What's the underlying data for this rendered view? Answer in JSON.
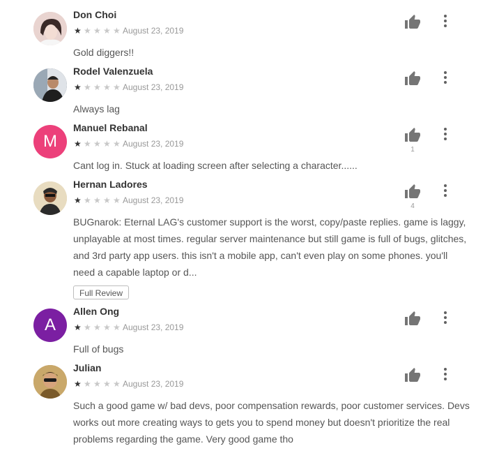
{
  "reviews": [
    {
      "name": "Don Choi",
      "rating": 1,
      "date": "August 23, 2019",
      "text": "Gold diggers!!",
      "helpful": "",
      "avatar": {
        "type": "photo",
        "bg": "#e6c7c4"
      }
    },
    {
      "name": "Rodel Valenzuela",
      "rating": 1,
      "date": "August 23, 2019",
      "text": "Always lag",
      "helpful": "",
      "avatar": {
        "type": "photo",
        "bg": "#3b4652"
      }
    },
    {
      "name": "Manuel Rebanal",
      "rating": 1,
      "date": "August 23, 2019",
      "text": "Cant log in. Stuck at loading screen after selecting a character......",
      "helpful": "1",
      "avatar": {
        "type": "letter",
        "letter": "M",
        "bg": "#ec407a"
      }
    },
    {
      "name": "Hernan Ladores",
      "rating": 1,
      "date": "August 23, 2019",
      "text": "BUGnarok: Eternal LAG's customer support is the worst, copy/paste replies. game is laggy, unplayable at most times. regular server maintenance but still game is full of bugs, glitches, and 3rd party app users. this isn't a mobile app, can't even play on some phones. you'll need a capable laptop or d...",
      "helpful": "4",
      "avatar": {
        "type": "photo",
        "bg": "#d9c9a6"
      },
      "full_review_label": "Full Review"
    },
    {
      "name": "Allen Ong",
      "rating": 1,
      "date": "August 23, 2019",
      "text": "Full of bugs",
      "helpful": "",
      "avatar": {
        "type": "letter",
        "letter": "A",
        "bg": "#7b1fa2"
      }
    },
    {
      "name": "Julian",
      "rating": 1,
      "date": "August 23, 2019",
      "text": "Such a good game w/ bad devs, poor compensation rewards, poor customer services. Devs works out more creating ways to gets you to spend money but doesn't prioritize the real problems regarding the game. Very good game tho",
      "helpful": "",
      "avatar": {
        "type": "photo",
        "bg": "#b89a62"
      }
    }
  ],
  "icons": {
    "thumb": "thumb-up-icon",
    "menu": "more-vert-icon",
    "star": "star-icon"
  },
  "colors": {
    "star_on": "#333333",
    "star_off": "#c8c8c8"
  }
}
